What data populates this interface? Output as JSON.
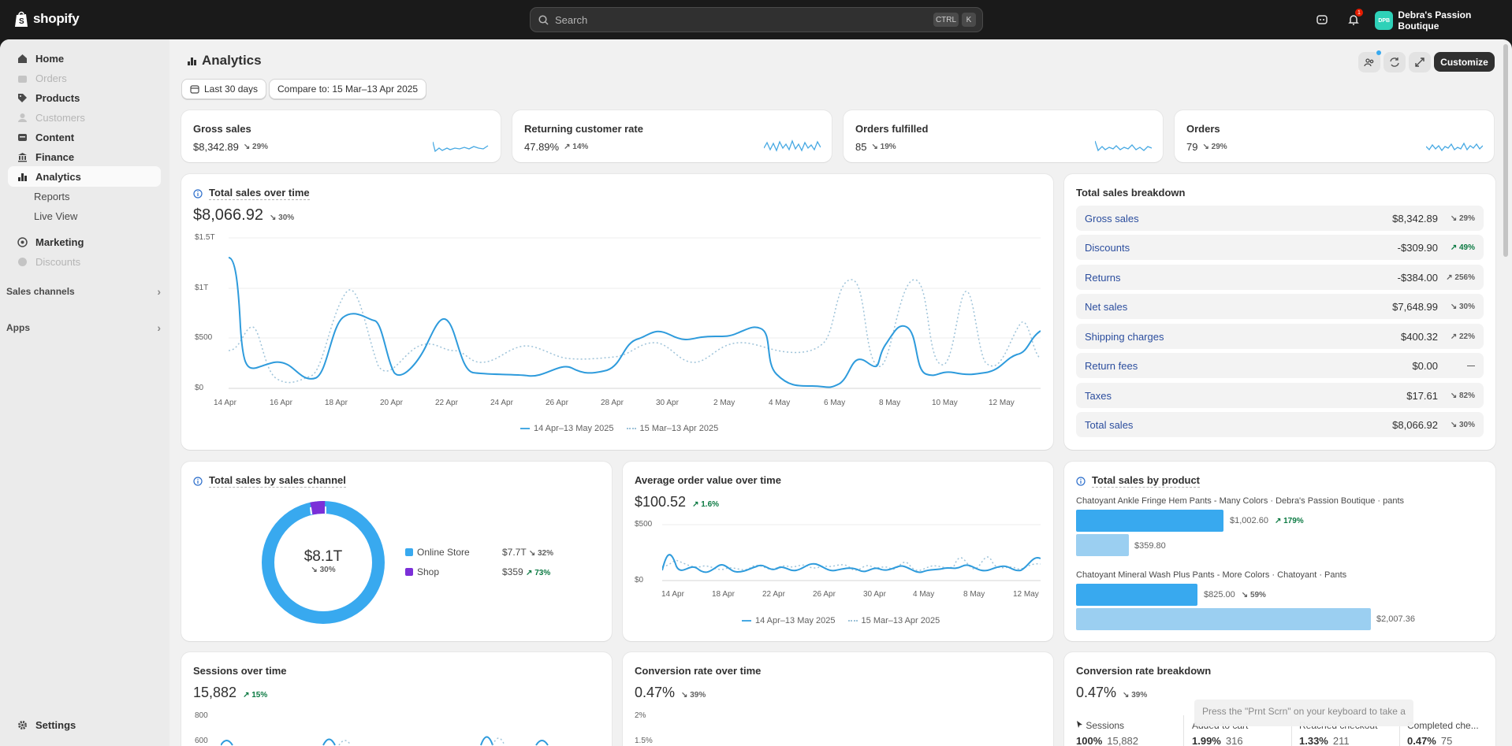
{
  "topbar": {
    "brand": "shopify",
    "search_placeholder": "Search",
    "kbd_ctrl": "CTRL",
    "kbd_k": "K",
    "notif_count": "1",
    "store_initials": "DPB",
    "store_name": "Debra's Passion Boutique"
  },
  "sidebar": {
    "items": [
      {
        "label": "Home",
        "icon": "home-icon",
        "disabled": false
      },
      {
        "label": "Orders",
        "icon": "orders-icon",
        "disabled": true
      },
      {
        "label": "Products",
        "icon": "tag-icon",
        "disabled": false
      },
      {
        "label": "Customers",
        "icon": "person-icon",
        "disabled": true
      },
      {
        "label": "Content",
        "icon": "content-icon",
        "disabled": false
      },
      {
        "label": "Finance",
        "icon": "bank-icon",
        "disabled": false
      },
      {
        "label": "Analytics",
        "icon": "chart-icon",
        "disabled": false,
        "active": true
      }
    ],
    "sub_reports": "Reports",
    "sub_live": "Live View",
    "marketing": "Marketing",
    "discounts": "Discounts",
    "sales_channels": "Sales channels",
    "apps": "Apps",
    "settings": "Settings"
  },
  "page": {
    "title": "Analytics",
    "date_range": "Last 30 days",
    "compare": "Compare to: 15 Mar–13 Apr 2025",
    "customize": "Customize"
  },
  "kpis": [
    {
      "label": "Gross sales",
      "value": "$8,342.89",
      "change": "29%",
      "dir": "down"
    },
    {
      "label": "Returning customer rate",
      "value": "47.89%",
      "change": "14%",
      "dir": "up"
    },
    {
      "label": "Orders fulfilled",
      "value": "85",
      "change": "19%",
      "dir": "down"
    },
    {
      "label": "Orders",
      "value": "79",
      "change": "29%",
      "dir": "down"
    }
  ],
  "total_sales": {
    "title": "Total sales over time",
    "value": "$8,066.92",
    "change": "30%",
    "y_ticks": [
      "$1.5T",
      "$1T",
      "$500",
      "$0"
    ],
    "x_ticks": [
      "14 Apr",
      "16 Apr",
      "18 Apr",
      "20 Apr",
      "22 Apr",
      "24 Apr",
      "26 Apr",
      "28 Apr",
      "30 Apr",
      "2 May",
      "4 May",
      "6 May",
      "8 May",
      "10 May",
      "12 May"
    ],
    "legend_current": "14 Apr–13 May 2025",
    "legend_previous": "15 Mar–13 Apr 2025"
  },
  "breakdown": {
    "title": "Total sales breakdown",
    "rows": [
      {
        "label": "Gross sales",
        "value": "$8,342.89",
        "change": "29%",
        "dir": "down"
      },
      {
        "label": "Discounts",
        "value": "-$309.90",
        "change": "49%",
        "dir": "up"
      },
      {
        "label": "Returns",
        "value": "-$384.00",
        "change": "256%",
        "dir": "up-neutral"
      },
      {
        "label": "Net sales",
        "value": "$7,648.99",
        "change": "30%",
        "dir": "down"
      },
      {
        "label": "Shipping charges",
        "value": "$400.32",
        "change": "22%",
        "dir": "up-neutral"
      },
      {
        "label": "Return fees",
        "value": "$0.00",
        "change": "—",
        "dir": "none"
      },
      {
        "label": "Taxes",
        "value": "$17.61",
        "change": "82%",
        "dir": "down"
      },
      {
        "label": "Total sales",
        "value": "$8,066.92",
        "change": "30%",
        "dir": "down"
      }
    ]
  },
  "by_channel": {
    "title": "Total sales by sales channel",
    "center_value": "$8.1T",
    "center_change": "30%",
    "items": [
      {
        "name": "Online Store",
        "value": "$7.7T",
        "change": "32%",
        "dir": "down",
        "color": "#38a9ef"
      },
      {
        "name": "Shop",
        "value": "$359",
        "change": "73%",
        "dir": "up",
        "color": "#7b2fd8"
      }
    ]
  },
  "aov": {
    "title": "Average order value over time",
    "value": "$100.52",
    "change": "1.6%",
    "y_ticks": [
      "$500",
      "$0"
    ],
    "x_ticks": [
      "14 Apr",
      "18 Apr",
      "22 Apr",
      "26 Apr",
      "30 Apr",
      "4 May",
      "8 May",
      "12 May"
    ],
    "legend_current": "14 Apr–13 May 2025",
    "legend_previous": "15 Mar–13 Apr 2025"
  },
  "by_product": {
    "title": "Total sales by product",
    "products": [
      {
        "name": "Chatoyant Ankle Fringe Hem Pants - Many Colors · Debra's Passion Boutique · pants",
        "current": "$1,002.60",
        "change": "179%",
        "previous": "$359.80"
      },
      {
        "name": "Chatoyant Mineral Wash Plus Pants - More Colors · Chatoyant · Pants",
        "current": "$825.00",
        "change": "59%",
        "previous": "$2,007.36"
      }
    ]
  },
  "sessions": {
    "title": "Sessions over time",
    "value": "15,882",
    "change": "15%",
    "y_ticks": [
      "800",
      "600"
    ]
  },
  "conversion": {
    "title": "Conversion rate over time",
    "value": "0.47%",
    "change": "39%",
    "y_ticks": [
      "2%",
      "1.5%"
    ]
  },
  "conv_breakdown": {
    "title": "Conversion rate breakdown",
    "value": "0.47%",
    "change": "39%",
    "steps": [
      {
        "name": "Sessions",
        "pct": "100%",
        "count": "15,882"
      },
      {
        "name": "Added to cart",
        "pct": "1.99%",
        "count": "316"
      },
      {
        "name": "Reached checkout",
        "pct": "1.33%",
        "count": "211"
      },
      {
        "name": "Completed che...",
        "pct": "0.47%",
        "count": "75"
      }
    ]
  },
  "tooltip": "Press the \"Prnt Scrn\" on your keyboard to take a"
}
